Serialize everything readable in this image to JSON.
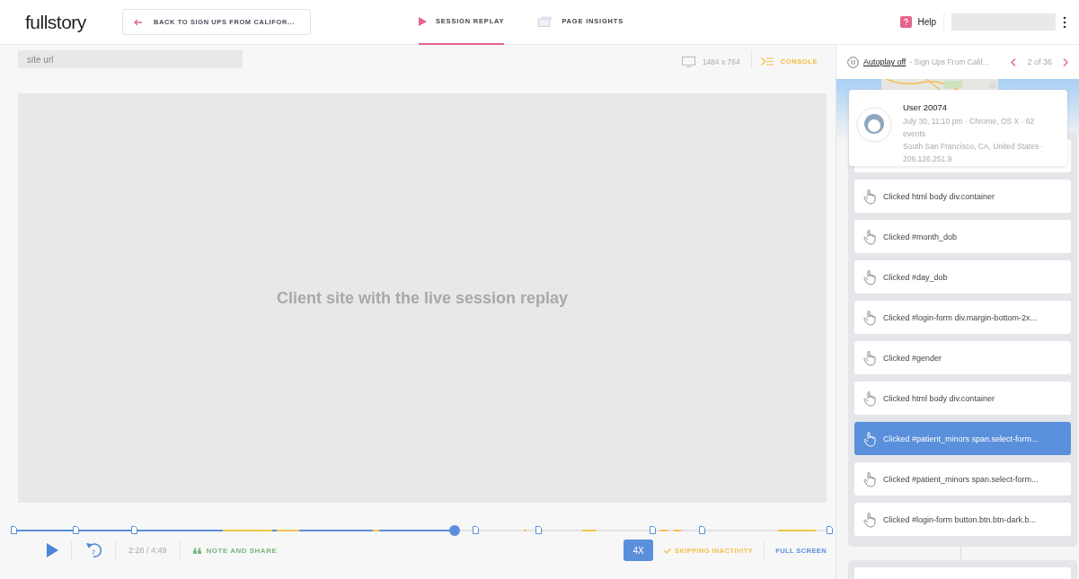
{
  "header": {
    "logo": "fullstory",
    "back_button": "BACK TO SIGN UPS FROM CALIFOR...",
    "tabs": [
      {
        "label": "SESSION REPLAY",
        "selected": true
      },
      {
        "label": "PAGE INSIGHTS",
        "selected": false
      }
    ],
    "help": "Help"
  },
  "viewer": {
    "url_placeholder": "site url",
    "resolution": "1484 x 764",
    "console": "CONSOLE",
    "placeholder_text": "Client site with the live session replay"
  },
  "player": {
    "level": 0.54,
    "skip_back": "7",
    "time": "2:28 / 4:49",
    "note_button": "NOTE AND SHARE",
    "speed": "4X",
    "skipping": {
      "label": "SKIPPING INACTIVITY",
      "on": true
    },
    "full_screen": "FULL SCREEN"
  },
  "sidebar": {
    "autoplay": "Autoplay off",
    "segment": "- Sign Ups From Calif...",
    "position": "2 of 36",
    "user": {
      "name": "User 20074",
      "details": "July 30, 11:10 pm · Chrome, OS X · 62 events",
      "location": "South San Francisco,  CA,  United States · 206.126.251.9"
    },
    "events": [
      {
        "kind": "click",
        "label": "Clicked html body div.container",
        "selected": false
      },
      {
        "kind": "click",
        "label": "Clicked #month_dob",
        "selected": false
      },
      {
        "kind": "click",
        "label": "Clicked #day_dob",
        "selected": false
      },
      {
        "kind": "click",
        "label": "Clicked #login-form div.margin-bottom-2x...",
        "selected": false
      },
      {
        "kind": "click",
        "label": "Clicked #gender",
        "selected": false
      },
      {
        "kind": "click",
        "label": "Clicked html body div.container",
        "selected": false
      },
      {
        "kind": "click",
        "label": "Clicked #patient_minors span.select-form...",
        "selected": true
      },
      {
        "kind": "click",
        "label": "Clicked #patient_minors span.select-form...",
        "selected": false
      },
      {
        "kind": "click",
        "label": "Clicked #login-form button.btn.btn-dark.b...",
        "selected": false
      }
    ]
  }
}
